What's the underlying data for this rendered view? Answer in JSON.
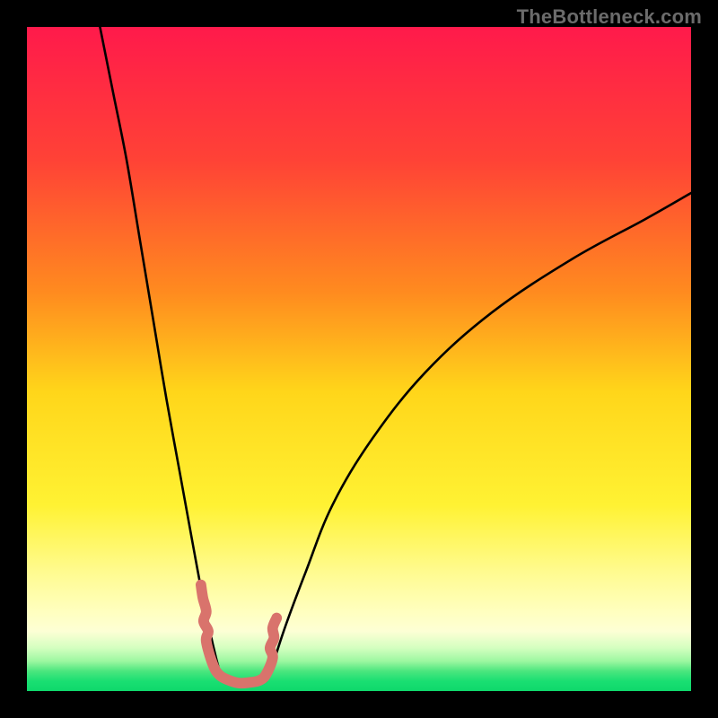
{
  "watermark": "TheBottleneck.com",
  "chart_data": {
    "type": "line",
    "title": "",
    "xlabel": "",
    "ylabel": "",
    "xlim": [
      0,
      100
    ],
    "ylim": [
      0,
      100
    ],
    "background_gradient": {
      "type": "vertical",
      "stops": [
        {
          "offset": 0.0,
          "color": "#ff1a4b"
        },
        {
          "offset": 0.2,
          "color": "#ff4236"
        },
        {
          "offset": 0.4,
          "color": "#ff8b1f"
        },
        {
          "offset": 0.55,
          "color": "#ffd61a"
        },
        {
          "offset": 0.72,
          "color": "#fff233"
        },
        {
          "offset": 0.82,
          "color": "#fffb8f"
        },
        {
          "offset": 0.88,
          "color": "#ffffbf"
        },
        {
          "offset": 0.91,
          "color": "#fdffd5"
        },
        {
          "offset": 0.935,
          "color": "#d4ffc0"
        },
        {
          "offset": 0.955,
          "color": "#9cf7a0"
        },
        {
          "offset": 0.97,
          "color": "#4be67e"
        },
        {
          "offset": 0.985,
          "color": "#1adf72"
        },
        {
          "offset": 1.0,
          "color": "#0fd86b"
        }
      ]
    },
    "series": [
      {
        "name": "left-curve",
        "type": "curve",
        "x": [
          11,
          13,
          15,
          17,
          19,
          21,
          23,
          25,
          26.5,
          28,
          29,
          29.5
        ],
        "y": [
          100,
          90,
          80,
          68,
          56,
          44,
          33,
          22,
          14,
          7,
          3,
          1.5
        ]
      },
      {
        "name": "right-curve",
        "type": "curve",
        "x": [
          36,
          37,
          39,
          42,
          46,
          52,
          60,
          70,
          82,
          93,
          100
        ],
        "y": [
          1.5,
          4,
          10,
          18,
          28,
          38,
          48,
          57,
          65,
          71,
          75
        ]
      },
      {
        "name": "valley-path",
        "type": "freeform-stroke",
        "color": "#d9736c",
        "width_norm": 0.016,
        "points": [
          {
            "x": 26.2,
            "y": 16.0
          },
          {
            "x": 26.5,
            "y": 14.0
          },
          {
            "x": 27.0,
            "y": 12.0
          },
          {
            "x": 26.6,
            "y": 10.5
          },
          {
            "x": 27.3,
            "y": 9.0
          },
          {
            "x": 27.0,
            "y": 7.5
          },
          {
            "x": 28.0,
            "y": 4.0
          },
          {
            "x": 29.0,
            "y": 2.4
          },
          {
            "x": 30.5,
            "y": 1.6
          },
          {
            "x": 32.0,
            "y": 1.2
          },
          {
            "x": 33.5,
            "y": 1.3
          },
          {
            "x": 35.0,
            "y": 1.6
          },
          {
            "x": 36.0,
            "y": 2.5
          },
          {
            "x": 37.0,
            "y": 5.0
          },
          {
            "x": 36.6,
            "y": 6.5
          },
          {
            "x": 37.2,
            "y": 8.0
          },
          {
            "x": 37.0,
            "y": 9.5
          },
          {
            "x": 37.6,
            "y": 11.0
          }
        ]
      }
    ]
  }
}
